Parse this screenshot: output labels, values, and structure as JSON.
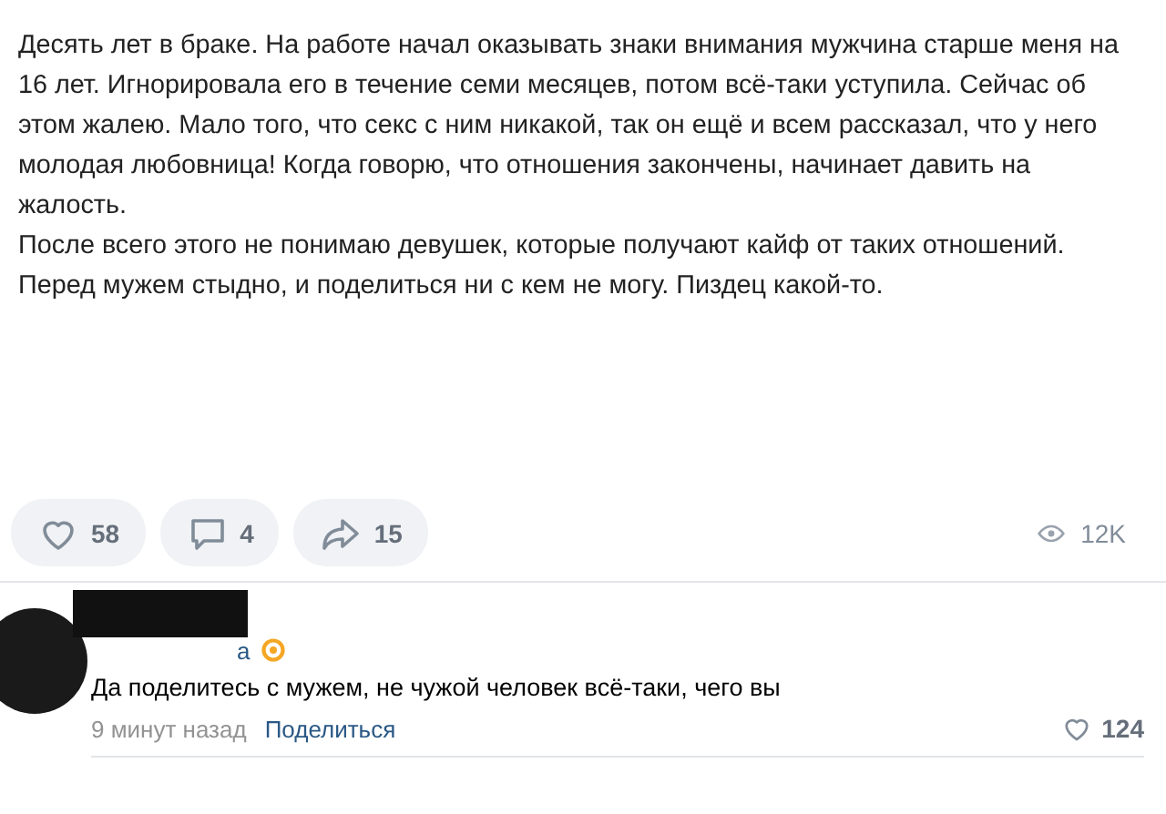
{
  "post": {
    "paragraphs": [
      "Десять лет в браке. На работе начал оказывать знаки внимания мужчина старше меня на 16 лет. Игнорировала его в течение семи месяцев, потом всё-таки уступила. Сейчас об этом жалею. Мало того, что секс с ним никакой, так он ещё и всем рассказал, что у него молодая любовница! Когда говорю, что отношения закончены, начинает давить на жалость.",
      "После всего этого не понимаю девушек, которые получают кайф от таких отношений. Перед мужем стыдно, и поделиться ни с кем не могу. Пиздец какой-то."
    ]
  },
  "actions": [
    {
      "kind": "like",
      "count": "58"
    },
    {
      "kind": "comment",
      "count": "4"
    },
    {
      "kind": "share",
      "count": "15"
    }
  ],
  "views": "12K",
  "comment": {
    "author": "а",
    "verified": true,
    "text": "Да поделитесь с мужем, не чужой человек всё-таки, чего вы",
    "time": "9 минут назад",
    "reply_link": "Поделиться",
    "likes": "124"
  }
}
